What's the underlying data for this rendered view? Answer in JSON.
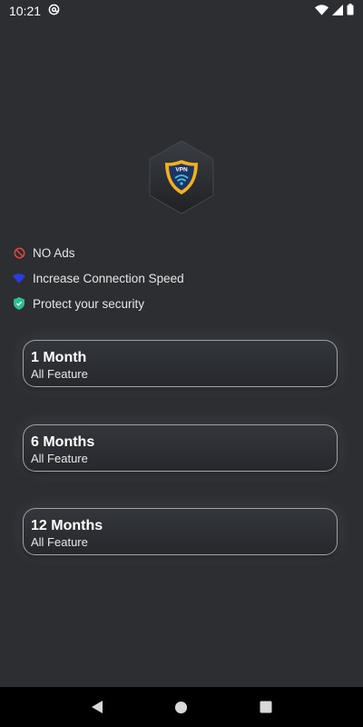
{
  "status_bar": {
    "time": "10:21",
    "icons": [
      "at-sign-icon",
      "wifi-icon",
      "signal-icon",
      "battery-icon"
    ]
  },
  "logo": {
    "text": "VPN",
    "icon": "shield-wifi-icon",
    "accent_color": "#f2b01e"
  },
  "features": [
    {
      "label": "NO Ads",
      "icon": "no-ads-icon",
      "color": "#e0483f"
    },
    {
      "label": "Increase Connection Speed",
      "icon": "wifi-icon",
      "color": "#2b3be0"
    },
    {
      "label": "Protect your security",
      "icon": "shield-check-icon",
      "color": "#2bbf8e"
    }
  ],
  "plans": [
    {
      "title": "1 Month",
      "subtitle": "All Feature"
    },
    {
      "title": "6 Months",
      "subtitle": "All Feature"
    },
    {
      "title": "12 Months",
      "subtitle": "All Feature"
    }
  ],
  "nav_bar": {
    "buttons": [
      "back-icon",
      "home-icon",
      "recents-icon"
    ]
  }
}
